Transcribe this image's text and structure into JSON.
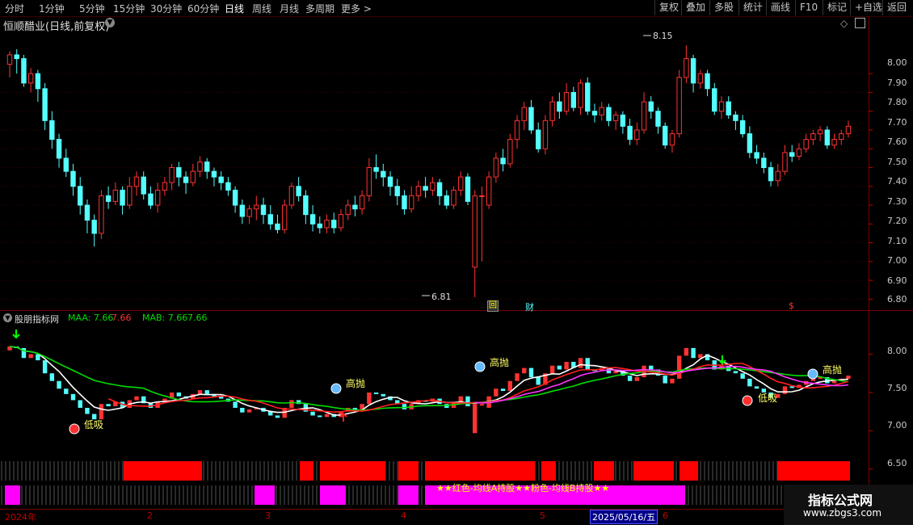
{
  "toolbar": {
    "periods": [
      "分时",
      "1分钟",
      "5分钟",
      "15分钟",
      "30分钟",
      "60分钟",
      "日线",
      "周线",
      "月线",
      "多周期",
      "更多 >"
    ],
    "active_period": "日线",
    "right_buttons": [
      "复权",
      "叠加",
      "多股",
      "统计",
      "画线",
      "F10",
      "标记",
      "+自选",
      "返回"
    ]
  },
  "stock": {
    "title": "恒顺醋业(日线,前复权)",
    "dropdown_icon": "chevron-down-icon"
  },
  "main_chart": {
    "high_label": "8.15",
    "low_label": "6.81",
    "price_axis": [
      "8.00",
      "7.90",
      "7.80",
      "7.70",
      "7.60",
      "7.50",
      "7.40",
      "7.30",
      "7.20",
      "7.10",
      "7.00",
      "6.90",
      "6.80"
    ],
    "markers": [
      {
        "text": "回"
      },
      {
        "text": "财"
      },
      {
        "text": "$"
      }
    ]
  },
  "indicator": {
    "name": "股朋指标网",
    "maa_label": "MAA: 7.66",
    "maa_val2": "7.66",
    "mab_label": "MAB: 7.66",
    "mab_val2": "7.66",
    "axis": [
      "8.00",
      "7.50",
      "7.00",
      "6.50"
    ],
    "signals": [
      {
        "text": "低吸"
      },
      {
        "text": "高抛"
      },
      {
        "text": "高抛"
      },
      {
        "text": "低吸"
      },
      {
        "text": "高抛"
      }
    ],
    "band_caption": "★★红色-均线A持股★★粉色-均线B持股★★"
  },
  "time_axis": {
    "labels": [
      "2024年",
      "2",
      "3",
      "4",
      "5",
      "2025/05/16/五",
      "6"
    ]
  },
  "watermark": {
    "line1": "指标公式网",
    "line2": "www.zbgs3.com"
  },
  "colors": {
    "up": "#ff3333",
    "down": "#54ffff",
    "maa": "#ffffff",
    "mab": "#00dd00",
    "line_red": "#ff2020",
    "line_pink": "#ff33ff",
    "band_red": "#ff0000",
    "band_pink": "#ff00ff"
  },
  "chart_data": {
    "type": "candlestick",
    "ylim": [
      6.78,
      8.22
    ],
    "candles": [
      [
        8.05,
        8.1,
        8.12,
        7.98
      ],
      [
        8.1,
        8.08,
        8.13,
        8.0
      ],
      [
        8.08,
        7.95,
        8.1,
        7.93
      ],
      [
        7.95,
        8.0,
        8.03,
        7.9
      ],
      [
        8.0,
        7.92,
        8.02,
        7.85
      ],
      [
        7.92,
        7.75,
        7.95,
        7.7
      ],
      [
        7.75,
        7.65,
        7.8,
        7.6
      ],
      [
        7.65,
        7.55,
        7.68,
        7.5
      ],
      [
        7.55,
        7.48,
        7.6,
        7.45
      ],
      [
        7.48,
        7.4,
        7.52,
        7.35
      ],
      [
        7.4,
        7.3,
        7.45,
        7.25
      ],
      [
        7.3,
        7.22,
        7.33,
        7.15
      ],
      [
        7.22,
        7.15,
        7.25,
        7.08
      ],
      [
        7.15,
        7.35,
        7.38,
        7.12
      ],
      [
        7.35,
        7.32,
        7.4,
        7.28
      ],
      [
        7.32,
        7.38,
        7.42,
        7.3
      ],
      [
        7.38,
        7.3,
        7.4,
        7.25
      ],
      [
        7.3,
        7.4,
        7.45,
        7.28
      ],
      [
        7.4,
        7.45,
        7.48,
        7.35
      ],
      [
        7.45,
        7.36,
        7.48,
        7.33
      ],
      [
        7.36,
        7.3,
        7.4,
        7.28
      ],
      [
        7.3,
        7.38,
        7.42,
        7.26
      ],
      [
        7.38,
        7.42,
        7.45,
        7.35
      ],
      [
        7.42,
        7.5,
        7.52,
        7.38
      ],
      [
        7.5,
        7.45,
        7.53,
        7.4
      ],
      [
        7.45,
        7.42,
        7.48,
        7.36
      ],
      [
        7.42,
        7.48,
        7.52,
        7.4
      ],
      [
        7.48,
        7.53,
        7.56,
        7.45
      ],
      [
        7.53,
        7.48,
        7.55,
        7.44
      ],
      [
        7.48,
        7.45,
        7.5,
        7.4
      ],
      [
        7.45,
        7.42,
        7.48,
        7.38
      ],
      [
        7.42,
        7.38,
        7.45,
        7.35
      ],
      [
        7.38,
        7.3,
        7.4,
        7.26
      ],
      [
        7.3,
        7.24,
        7.33,
        7.2
      ],
      [
        7.24,
        7.28,
        7.3,
        7.2
      ],
      [
        7.28,
        7.3,
        7.35,
        7.22
      ],
      [
        7.3,
        7.25,
        7.34,
        7.2
      ],
      [
        7.25,
        7.2,
        7.3,
        7.17
      ],
      [
        7.2,
        7.17,
        7.25,
        7.15
      ],
      [
        7.17,
        7.3,
        7.33,
        7.15
      ],
      [
        7.3,
        7.4,
        7.42,
        7.28
      ],
      [
        7.4,
        7.35,
        7.45,
        7.32
      ],
      [
        7.35,
        7.25,
        7.38,
        7.2
      ],
      [
        7.25,
        7.2,
        7.3,
        7.16
      ],
      [
        7.2,
        7.18,
        7.24,
        7.15
      ],
      [
        7.18,
        7.22,
        7.25,
        7.15
      ],
      [
        7.22,
        7.18,
        7.26,
        7.15
      ],
      [
        7.18,
        7.25,
        7.28,
        7.16
      ],
      [
        7.25,
        7.3,
        7.33,
        7.22
      ],
      [
        7.3,
        7.28,
        7.35,
        7.24
      ],
      [
        7.28,
        7.35,
        7.38,
        7.25
      ],
      [
        7.35,
        7.5,
        7.55,
        7.32
      ],
      [
        7.5,
        7.48,
        7.57,
        7.44
      ],
      [
        7.48,
        7.45,
        7.52,
        7.4
      ],
      [
        7.45,
        7.4,
        7.48,
        7.35
      ],
      [
        7.4,
        7.35,
        7.44,
        7.3
      ],
      [
        7.35,
        7.28,
        7.38,
        7.25
      ],
      [
        7.28,
        7.35,
        7.4,
        7.26
      ],
      [
        7.35,
        7.4,
        7.43,
        7.32
      ],
      [
        7.4,
        7.38,
        7.45,
        7.34
      ],
      [
        7.38,
        7.42,
        7.45,
        7.35
      ],
      [
        7.42,
        7.35,
        7.44,
        7.3
      ],
      [
        7.35,
        7.3,
        7.38,
        7.28
      ],
      [
        7.3,
        7.38,
        7.4,
        7.28
      ],
      [
        7.38,
        7.45,
        7.48,
        7.35
      ],
      [
        7.45,
        7.32,
        7.47,
        7.3
      ],
      [
        6.97,
        7.35,
        7.38,
        6.81
      ],
      [
        7.35,
        7.35,
        7.4,
        7.0
      ],
      [
        7.3,
        7.45,
        7.48,
        7.28
      ],
      [
        7.45,
        7.55,
        7.58,
        7.42
      ],
      [
        7.55,
        7.52,
        7.6,
        7.48
      ],
      [
        7.52,
        7.65,
        7.68,
        7.5
      ],
      [
        7.65,
        7.75,
        7.78,
        7.6
      ],
      [
        7.75,
        7.82,
        7.85,
        7.7
      ],
      [
        7.82,
        7.7,
        7.86,
        7.68
      ],
      [
        7.7,
        7.6,
        7.74,
        7.58
      ],
      [
        7.6,
        7.75,
        7.78,
        7.57
      ],
      [
        7.75,
        7.85,
        7.88,
        7.72
      ],
      [
        7.85,
        7.8,
        7.9,
        7.76
      ],
      [
        7.8,
        7.9,
        7.95,
        7.78
      ],
      [
        7.9,
        7.82,
        7.93,
        7.8
      ],
      [
        7.82,
        7.95,
        7.97,
        7.78
      ],
      [
        7.95,
        7.8,
        7.98,
        7.78
      ],
      [
        7.8,
        7.78,
        7.84,
        7.74
      ],
      [
        7.78,
        7.82,
        7.85,
        7.75
      ],
      [
        7.82,
        7.75,
        7.84,
        7.72
      ],
      [
        7.75,
        7.78,
        7.8,
        7.7
      ],
      [
        7.78,
        7.72,
        7.8,
        7.68
      ],
      [
        7.72,
        7.65,
        7.76,
        7.62
      ],
      [
        7.65,
        7.7,
        7.74,
        7.62
      ],
      [
        7.7,
        7.85,
        7.9,
        7.68
      ],
      [
        7.85,
        7.8,
        7.88,
        7.76
      ],
      [
        7.8,
        7.72,
        7.82,
        7.68
      ],
      [
        7.72,
        7.62,
        7.74,
        7.6
      ],
      [
        7.62,
        7.68,
        7.7,
        7.58
      ],
      [
        7.68,
        7.98,
        8.02,
        7.66
      ],
      [
        7.98,
        8.08,
        8.15,
        7.95
      ],
      [
        8.08,
        7.95,
        8.1,
        7.9
      ],
      [
        7.95,
        8.0,
        8.02,
        7.92
      ],
      [
        8.0,
        7.92,
        8.02,
        7.88
      ],
      [
        7.92,
        7.8,
        7.95,
        7.78
      ],
      [
        7.8,
        7.85,
        7.88,
        7.76
      ],
      [
        7.85,
        7.78,
        7.88,
        7.76
      ],
      [
        7.78,
        7.75,
        7.8,
        7.7
      ],
      [
        7.75,
        7.68,
        7.78,
        7.66
      ],
      [
        7.68,
        7.58,
        7.72,
        7.55
      ],
      [
        7.58,
        7.55,
        7.62,
        7.52
      ],
      [
        7.55,
        7.5,
        7.58,
        7.47
      ],
      [
        7.5,
        7.43,
        7.53,
        7.4
      ],
      [
        7.43,
        7.48,
        7.52,
        7.4
      ],
      [
        7.48,
        7.58,
        7.62,
        7.46
      ],
      [
        7.58,
        7.56,
        7.62,
        7.53
      ],
      [
        7.56,
        7.6,
        7.63,
        7.54
      ],
      [
        7.6,
        7.65,
        7.68,
        7.58
      ],
      [
        7.65,
        7.68,
        7.7,
        7.62
      ],
      [
        7.68,
        7.7,
        7.72,
        7.64
      ],
      [
        7.7,
        7.62,
        7.72,
        7.6
      ],
      [
        7.62,
        7.65,
        7.68,
        7.6
      ],
      [
        7.65,
        7.68,
        7.7,
        7.62
      ],
      [
        7.68,
        7.72,
        7.75,
        7.66
      ]
    ]
  }
}
